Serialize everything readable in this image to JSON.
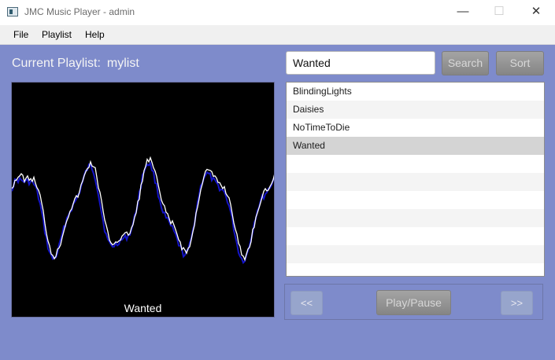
{
  "window": {
    "title": "JMC Music Player - admin",
    "minimize_label": "—",
    "maximize_label": "☐",
    "close_label": "✕"
  },
  "menu": {
    "items": [
      "File",
      "Playlist",
      "Help"
    ]
  },
  "playlist": {
    "label": "Current Playlist:",
    "name": "mylist"
  },
  "search": {
    "value": "Wanted",
    "search_label": "Search",
    "sort_label": "Sort"
  },
  "songs": {
    "items": [
      "BlindingLights",
      "Daisies",
      "NoTimeToDie",
      "Wanted"
    ],
    "selected": "Wanted"
  },
  "visualizer": {
    "now_playing": "Wanted",
    "colors": {
      "background": "#000000",
      "line_primary": "#ffffff",
      "line_secondary": "#1414c8"
    }
  },
  "controls": {
    "prev_label": "<<",
    "play_label": "Play/Pause",
    "next_label": ">>"
  },
  "theme": {
    "accent_background": "#7e8bcb"
  }
}
